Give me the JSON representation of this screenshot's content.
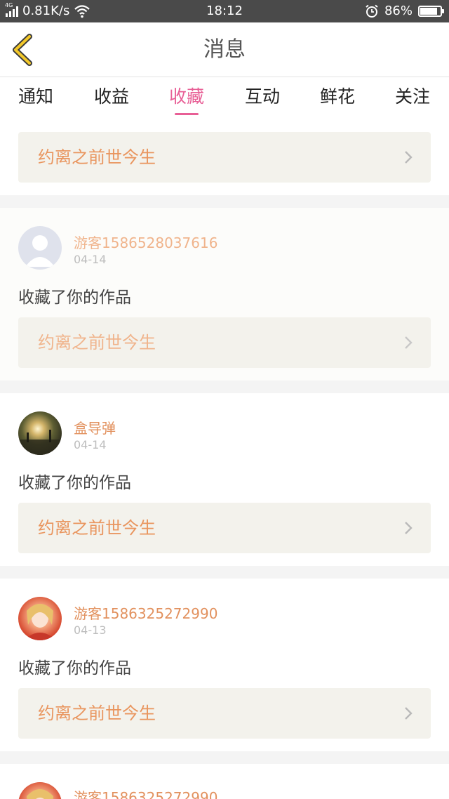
{
  "status_bar": {
    "network_tag": "4G",
    "speed": "0.81K/s",
    "time": "18:12",
    "battery": "86%",
    "battery_level": 0.86
  },
  "header": {
    "title": "消息"
  },
  "tabs": [
    {
      "label": "通知"
    },
    {
      "label": "收益"
    },
    {
      "label": "收藏"
    },
    {
      "label": "互动"
    },
    {
      "label": "鲜花"
    },
    {
      "label": "关注"
    }
  ],
  "active_tab": "收藏",
  "colors": {
    "accent": "#e85f96",
    "username": "#e2915e",
    "work_title": "#e9955e",
    "back_arrow": "#f3c82a"
  },
  "top_work": {
    "title": "约离之前世今生"
  },
  "messages": [
    {
      "user": "游客1586528037616",
      "date": "04-14",
      "action": "收藏了你的作品",
      "work": "约离之前世今生",
      "avatar": "default-avatar-icon"
    },
    {
      "user": "盒导弹",
      "date": "04-14",
      "action": "收藏了你的作品",
      "work": "约离之前世今生",
      "avatar": "sunset-photo-avatar"
    },
    {
      "user": "游客1586325272990",
      "date": "04-13",
      "action": "收藏了你的作品",
      "work": "约离之前世今生",
      "avatar": "anime-girl-avatar"
    },
    {
      "user": "游客1586325272990"
    }
  ]
}
